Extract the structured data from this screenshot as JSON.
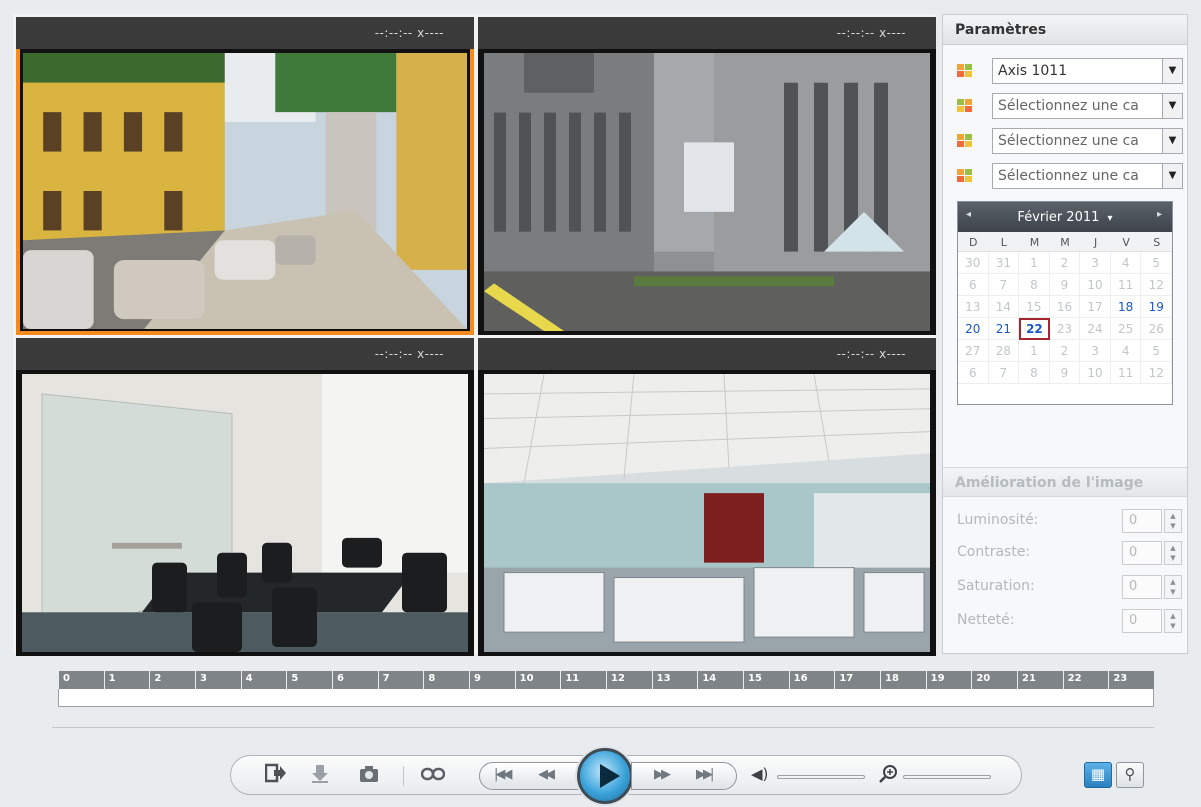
{
  "viewer": {
    "cameras": [
      {
        "timestamp": "--:--:-- x----",
        "scene": "street"
      },
      {
        "timestamp": "--:--:-- x----",
        "scene": "buildings"
      },
      {
        "timestamp": "--:--:-- x----",
        "scene": "meeting-room"
      },
      {
        "timestamp": "--:--:-- x----",
        "scene": "office"
      }
    ],
    "active_index": 0
  },
  "panel": {
    "title": "Paramètres",
    "camera_selects": [
      {
        "value": "Axis 1011"
      },
      {
        "value": "Sélectionnez une ca"
      },
      {
        "value": "Sélectionnez une ca"
      },
      {
        "value": "Sélectionnez une ca"
      }
    ],
    "calendar": {
      "month": "Février 2011",
      "prev": "◂",
      "next": "▸",
      "dropdown": "▾",
      "weekdays": [
        "D",
        "L",
        "M",
        "M",
        "J",
        "V",
        "S"
      ],
      "days": [
        {
          "d": "30",
          "s": "other"
        },
        {
          "d": "31",
          "s": "other"
        },
        {
          "d": "1",
          "s": "other"
        },
        {
          "d": "2",
          "s": "other"
        },
        {
          "d": "3",
          "s": "other"
        },
        {
          "d": "4",
          "s": "other"
        },
        {
          "d": "5",
          "s": "other"
        },
        {
          "d": "6",
          "s": "other"
        },
        {
          "d": "7",
          "s": "other"
        },
        {
          "d": "8",
          "s": "other"
        },
        {
          "d": "9",
          "s": "other"
        },
        {
          "d": "10",
          "s": "other"
        },
        {
          "d": "11",
          "s": "other"
        },
        {
          "d": "12",
          "s": "other"
        },
        {
          "d": "13",
          "s": "other"
        },
        {
          "d": "14",
          "s": "other"
        },
        {
          "d": "15",
          "s": "other"
        },
        {
          "d": "16",
          "s": "other"
        },
        {
          "d": "17",
          "s": "other"
        },
        {
          "d": "18",
          "s": "cur"
        },
        {
          "d": "19",
          "s": "cur"
        },
        {
          "d": "20",
          "s": "cur"
        },
        {
          "d": "21",
          "s": "cur"
        },
        {
          "d": "22",
          "s": "today"
        },
        {
          "d": "23",
          "s": "other"
        },
        {
          "d": "24",
          "s": "other"
        },
        {
          "d": "25",
          "s": "other"
        },
        {
          "d": "26",
          "s": "other"
        },
        {
          "d": "27",
          "s": "other"
        },
        {
          "d": "28",
          "s": "other"
        },
        {
          "d": "1",
          "s": "other"
        },
        {
          "d": "2",
          "s": "other"
        },
        {
          "d": "3",
          "s": "other"
        },
        {
          "d": "4",
          "s": "other"
        },
        {
          "d": "5",
          "s": "other"
        },
        {
          "d": "6",
          "s": "other"
        },
        {
          "d": "7",
          "s": "other"
        },
        {
          "d": "8",
          "s": "other"
        },
        {
          "d": "9",
          "s": "other"
        },
        {
          "d": "10",
          "s": "other"
        },
        {
          "d": "11",
          "s": "other"
        },
        {
          "d": "12",
          "s": "other"
        }
      ]
    },
    "enhancement": {
      "title": "Amélioration de l'image",
      "rows": [
        {
          "label": "Luminosité:",
          "value": "0"
        },
        {
          "label": "Contraste:",
          "value": "0"
        },
        {
          "label": "Saturation:",
          "value": "0"
        },
        {
          "label": "Netteté:",
          "value": "0"
        }
      ]
    }
  },
  "timeline": {
    "hours": [
      "0",
      "1",
      "2",
      "3",
      "4",
      "5",
      "6",
      "7",
      "8",
      "9",
      "10",
      "11",
      "12",
      "13",
      "14",
      "15",
      "16",
      "17",
      "18",
      "19",
      "20",
      "21",
      "22",
      "23"
    ]
  },
  "controls": {
    "export_icon": "export-icon",
    "download_icon": "download-icon",
    "snapshot_icon": "camera-icon",
    "link_icon": "link-icon",
    "volume": 0,
    "zoom": 0
  },
  "colors": {
    "active_border": "#f58a1f",
    "accent_blue": "#1a58c9",
    "today_border": "#a5262e"
  }
}
